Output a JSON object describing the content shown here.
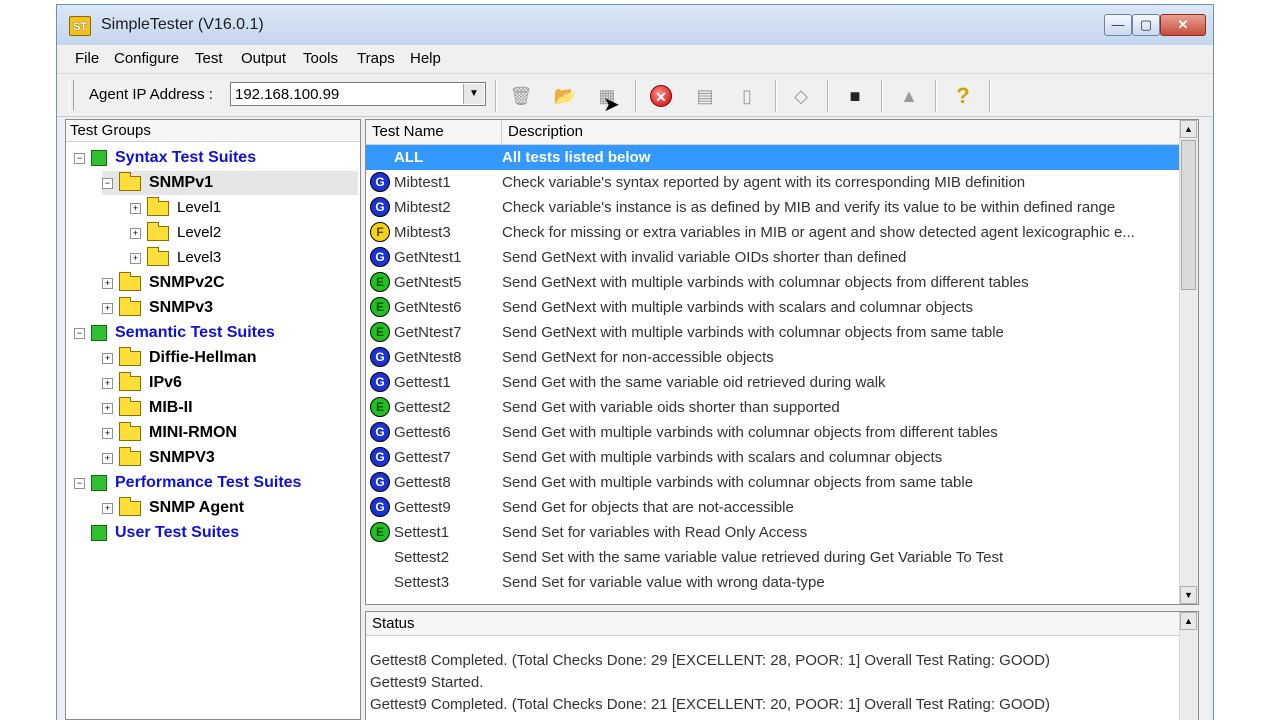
{
  "window": {
    "title": "SimpleTester (V16.0.1)",
    "app_icon": "ST",
    "minimize": "—",
    "maximize": "▢",
    "close": "✕"
  },
  "menu": [
    "File",
    "Configure",
    "Test",
    "Output",
    "Tools",
    "Traps",
    "Help"
  ],
  "toolbar": {
    "ip_label": "Agent IP Address :",
    "ip_value": "192.168.100.99",
    "dropdown_arrow": "▼",
    "icons": [
      "trash-icon",
      "open-folder-icon",
      "grid-icon",
      "stop-icon",
      "report-icon",
      "document-icon",
      "note-icon",
      "camera-icon",
      "triangle-icon",
      "help-icon"
    ]
  },
  "tree": {
    "header": "Test Groups",
    "nodes": [
      {
        "label": "Syntax Test Suites",
        "type": "suite",
        "level": 0,
        "exp": "−"
      },
      {
        "label": "SNMPv1",
        "type": "folder",
        "level": 1,
        "exp": "−"
      },
      {
        "label": "Level1",
        "type": "level",
        "level": 2,
        "exp": "+"
      },
      {
        "label": "Level2",
        "type": "level",
        "level": 2,
        "exp": "+"
      },
      {
        "label": "Level3",
        "type": "level",
        "level": 2,
        "exp": "+"
      },
      {
        "label": "SNMPv2C",
        "type": "folder",
        "level": 1,
        "exp": "+"
      },
      {
        "label": "SNMPv3",
        "type": "folder",
        "level": 1,
        "exp": "+"
      },
      {
        "label": "Semantic Test Suites",
        "type": "suite",
        "level": 0,
        "exp": "−"
      },
      {
        "label": "Diffie-Hellman",
        "type": "folder",
        "level": 1,
        "exp": "+"
      },
      {
        "label": "IPv6",
        "type": "folder",
        "level": 1,
        "exp": "+"
      },
      {
        "label": "MIB-II",
        "type": "folder",
        "level": 1,
        "exp": "+"
      },
      {
        "label": "MINI-RMON",
        "type": "folder",
        "level": 1,
        "exp": "+"
      },
      {
        "label": "SNMPV3",
        "type": "folder",
        "level": 1,
        "exp": "+"
      },
      {
        "label": "Performance Test Suites",
        "type": "suite",
        "level": 0,
        "exp": "−"
      },
      {
        "label": "SNMP Agent",
        "type": "folder",
        "level": 1,
        "exp": "+"
      },
      {
        "label": "User Test Suites",
        "type": "suite",
        "level": 0,
        "exp": ""
      }
    ]
  },
  "list": {
    "columns": [
      "Test Name",
      "Description"
    ],
    "rows": [
      {
        "name": "ALL",
        "desc": "All tests listed below",
        "badge": ""
      },
      {
        "name": "Mibtest1",
        "desc": "Check variable's syntax reported by agent with its corresponding MIB definition",
        "badge": "G"
      },
      {
        "name": "Mibtest2",
        "desc": "Check variable's instance is as defined by MIB and verify its value to be within defined range",
        "badge": "G"
      },
      {
        "name": "Mibtest3",
        "desc": "Check for missing or extra variables in MIB or agent and show detected agent lexicographic e...",
        "badge": "F"
      },
      {
        "name": "GetNtest1",
        "desc": "Send GetNext with invalid variable OIDs shorter than defined",
        "badge": "G"
      },
      {
        "name": "GetNtest5",
        "desc": "Send GetNext with multiple varbinds with columnar objects from different tables",
        "badge": "E"
      },
      {
        "name": "GetNtest6",
        "desc": "Send GetNext with multiple varbinds with scalars and columnar objects",
        "badge": "E"
      },
      {
        "name": "GetNtest7",
        "desc": "Send GetNext with multiple varbinds with columnar objects from same table",
        "badge": "E"
      },
      {
        "name": "GetNtest8",
        "desc": "Send GetNext for non-accessible objects",
        "badge": "G"
      },
      {
        "name": "Gettest1",
        "desc": "Send Get with the same variable oid retrieved during walk",
        "badge": "G"
      },
      {
        "name": "Gettest2",
        "desc": "Send Get with variable oids shorter than supported",
        "badge": "E"
      },
      {
        "name": "Gettest6",
        "desc": "Send Get with multiple varbinds with columnar objects from different tables",
        "badge": "G"
      },
      {
        "name": "Gettest7",
        "desc": "Send Get with multiple varbinds with scalars and columnar objects",
        "badge": "G"
      },
      {
        "name": "Gettest8",
        "desc": "Send Get with multiple varbinds with columnar objects from same table",
        "badge": "G"
      },
      {
        "name": "Gettest9",
        "desc": "Send Get for objects that are not-accessible",
        "badge": "G"
      },
      {
        "name": "Settest1",
        "desc": "Send Set for variables with Read Only Access",
        "badge": "E"
      },
      {
        "name": "Settest2",
        "desc": "Send Set with the same variable value retrieved during Get Variable To Test",
        "badge": ""
      },
      {
        "name": "Settest3",
        "desc": "Send Set for variable value with wrong data-type",
        "badge": ""
      }
    ]
  },
  "status": {
    "header": "Status",
    "lines": [
      "Gettest8 Completed. (Total Checks Done: 29 [EXCELLENT: 28, POOR: 1] Overall Test Rating: GOOD)",
      "Gettest9 Started.",
      "Gettest9 Completed. (Total Checks Done: 21 [EXCELLENT: 20, POOR: 1] Overall Test Rating: GOOD)"
    ]
  },
  "scroll": {
    "up": "▲",
    "down": "▼"
  }
}
